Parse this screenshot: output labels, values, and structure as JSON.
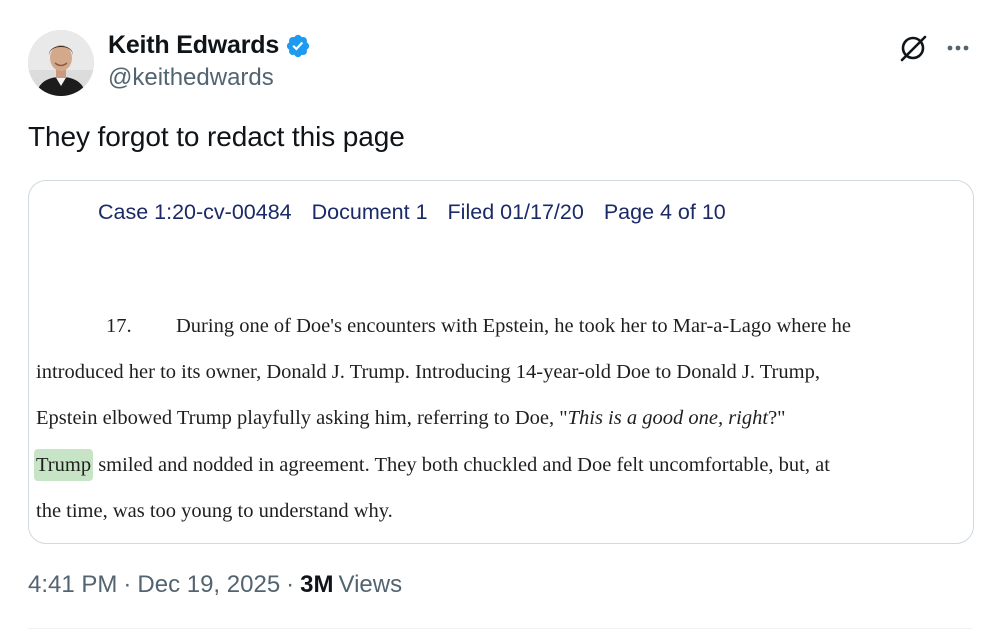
{
  "author": {
    "display_name": "Keith Edwards",
    "handle": "@keithedwards",
    "verified": true,
    "verified_color": "#1d9bf0"
  },
  "tweet": {
    "text": "They forgot to redact this page"
  },
  "document": {
    "header": {
      "case": "Case 1:20-cv-00484",
      "doc": "Document 1",
      "filed": "Filed 01/17/20",
      "page": "Page 4 of 10"
    },
    "paragraph_number": "17.",
    "line1": "During one of Doe's encounters with Epstein, he took her to Mar-a-Lago where he",
    "line2": "introduced her to its owner, Donald J. Trump.  Introducing 14-year-old Doe to Donald J. Trump,",
    "line3_start": "Epstein elbowed Trump playfully asking him, referring to Doe, \"",
    "line3_quote": "This is a good one, right",
    "line3_end": "?\"",
    "line4_highlight": "Trump",
    "line4_rest": " smiled and nodded in agreement. They both chuckled and Doe felt uncomfortable, but, at",
    "line5": "the time, was too young to understand why.",
    "highlight_color": "#c7e4c6"
  },
  "meta": {
    "time": "4:41 PM",
    "separator": "·",
    "date": "Dec 19, 2025",
    "views_count": "3M",
    "views_label": "Views"
  },
  "icons": {
    "grok": "grok-icon",
    "more": "more-horizontal-icon",
    "verified": "verified-badge-icon"
  }
}
